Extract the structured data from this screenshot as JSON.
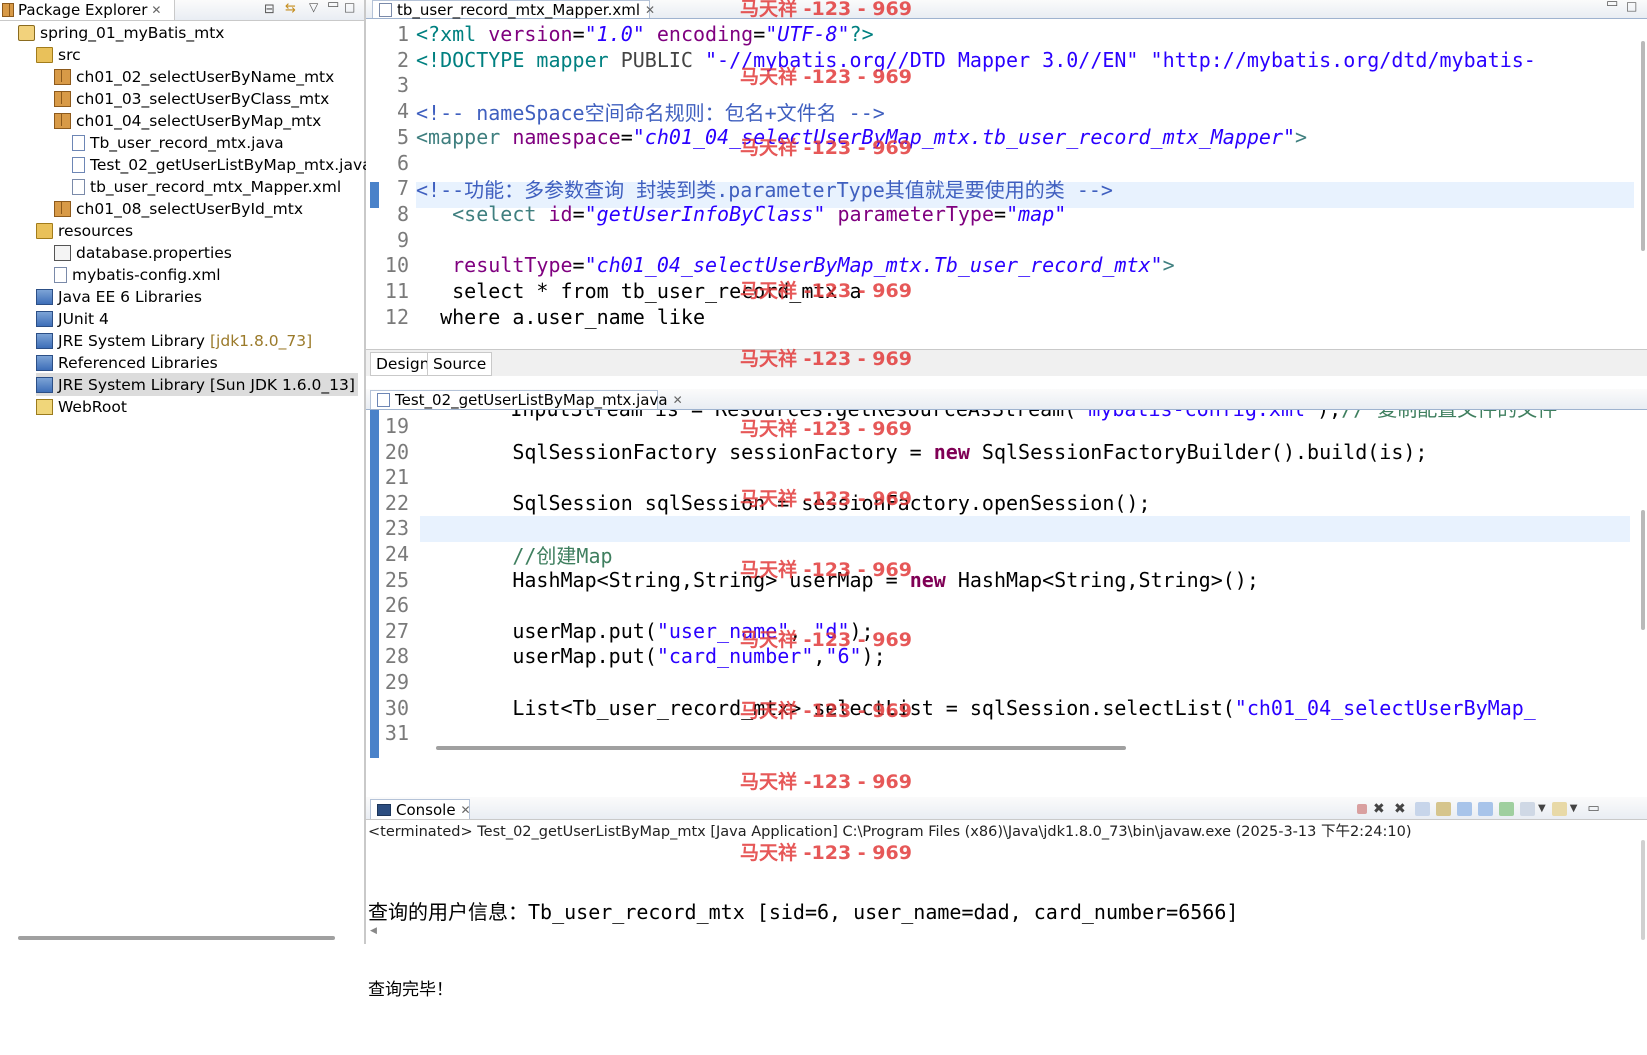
{
  "package_explorer": {
    "tab_label": "Package Explorer",
    "tree": [
      {
        "label": "spring_01_myBatis_mtx",
        "icon": "project-icon",
        "depth": 0
      },
      {
        "label": "src",
        "icon": "source-folder-icon",
        "depth": 1
      },
      {
        "label": "ch01_02_selectUserByName_mtx",
        "icon": "package-icon",
        "depth": 2
      },
      {
        "label": "ch01_03_selectUserByClass_mtx",
        "icon": "package-icon",
        "depth": 2
      },
      {
        "label": "ch01_04_selectUserByMap_mtx",
        "icon": "package-icon",
        "depth": 2
      },
      {
        "label": "Tb_user_record_mtx.java",
        "icon": "java-file-icon",
        "depth": 3
      },
      {
        "label": "Test_02_getUserListByMap_mtx.java",
        "icon": "java-file-icon",
        "depth": 3
      },
      {
        "label": "tb_user_record_mtx_Mapper.xml",
        "icon": "xml-file-icon",
        "depth": 3
      },
      {
        "label": "ch01_08_selectUserById_mtx",
        "icon": "package-icon",
        "depth": 2
      },
      {
        "label": "resources",
        "icon": "source-folder-icon",
        "depth": 1
      },
      {
        "label": "database.properties",
        "icon": "properties-file-icon",
        "depth": 2
      },
      {
        "label": "mybatis-config.xml",
        "icon": "xml-file-icon",
        "depth": 2
      },
      {
        "label": "Java EE 6 Libraries",
        "icon": "library-icon",
        "depth": 1
      },
      {
        "label": "JUnit 4",
        "icon": "library-icon",
        "depth": 1
      },
      {
        "label": "JRE System Library",
        "extra": "[jdk1.8.0_73]",
        "icon": "library-icon",
        "depth": 1
      },
      {
        "label": "Referenced Libraries",
        "icon": "library-icon",
        "depth": 1
      },
      {
        "label": "JRE System Library [Sun JDK 1.6.0_13]",
        "icon": "library-icon",
        "depth": 1,
        "selected": true
      },
      {
        "label": "WebRoot",
        "icon": "folder-icon",
        "depth": 1
      }
    ]
  },
  "editor_xml": {
    "tab_label": "tb_user_record_mtx_Mapper.xml",
    "bottom_tabs": [
      "Design",
      "Source"
    ],
    "lines": [
      {
        "n": "1",
        "html": "<span class=\"xdecl\">&lt;?xml</span> <span class=\"xattr\">version</span>=<span class=\"xval\">\"1.0\"</span> <span class=\"xattr\">encoding</span>=<span class=\"xval\">\"UTF-8\"</span><span class=\"xdecl\">?&gt;</span>"
      },
      {
        "n": "2",
        "html": "<span class=\"xdecl\">&lt;!DOCTYPE mapper</span> <span style=\"color:#444\">PUBLIC</span> <span class=\"str\">\"-//mybatis.org//DTD Mapper 3.0//EN\"</span> <span class=\"str\">\"http://mybatis.org/dtd/mybatis-</span>"
      },
      {
        "n": "3",
        "html": ""
      },
      {
        "n": "4",
        "html": "<span class=\"xcmt\">&lt;!-- nameSpace空间命名规则：包名+文件名 --&gt;</span>"
      },
      {
        "n": "5",
        "html": "<span class=\"xmltag\">&lt;mapper</span> <span class=\"xattr\">namespace</span>=<span class=\"xval\">\"ch01_04_selectUserByMap_mtx.tb_user_record_mtx_Mapper\"</span><span class=\"xmltag\">&gt;</span>"
      },
      {
        "n": "6",
        "html": ""
      },
      {
        "n": "7",
        "html": "<span class=\"xcmt\">&lt;!--功能：多参数查询 封装到类.parameterType其值就是要使用的类 --&gt;</span>"
      },
      {
        "n": "8",
        "html": "   <span class=\"xmltag\">&lt;select</span> <span class=\"xattr\">id</span>=<span class=\"xval\">\"getUserInfoByClass\"</span> <span class=\"xattr\">parameterType</span>=<span class=\"xval\">\"map\"</span>"
      },
      {
        "n": "9",
        "html": ""
      },
      {
        "n": "10",
        "html": "   <span class=\"xattr\">resultType</span>=<span class=\"xval\">\"ch01_04_selectUserByMap_mtx.Tb_user_record_mtx\"</span><span class=\"xmltag\">&gt;</span>"
      },
      {
        "n": "11",
        "html": "   select * from tb_user_record_mtx a"
      },
      {
        "n": "12",
        "html": "  where a.user_name like"
      }
    ]
  },
  "editor_java": {
    "tab_label": "Test_02_getUserListByMap_mtx.java",
    "partial_line_html": "        <span>InputStream is = Resources.getResourceAsStream(</span><span class=\"str\">\"mybatis-config.xml\"</span>);<span class=\"cmt\">// 复制配置文件的文件</span>",
    "lines": [
      {
        "n": "19",
        "html": ""
      },
      {
        "n": "20",
        "html": "        SqlSessionFactory sessionFactory = <span class=\"kw\">new</span> SqlSessionFactoryBuilder().build(is);"
      },
      {
        "n": "21",
        "html": ""
      },
      {
        "n": "22",
        "html": "        SqlSession sqlSession = sessionFactory.openSession();"
      },
      {
        "n": "23",
        "html": ""
      },
      {
        "n": "24",
        "html": "        <span class=\"cmt\">//创建Map</span>"
      },
      {
        "n": "25",
        "html": "        HashMap&lt;String,String&gt; userMap = <span class=\"kw\">new</span> HashMap&lt;String,String&gt;();"
      },
      {
        "n": "26",
        "html": ""
      },
      {
        "n": "27",
        "html": "        userMap.put(<span class=\"str\">\"user_name\"</span>, <span class=\"str\">\"d\"</span>);"
      },
      {
        "n": "28",
        "html": "        userMap.put(<span class=\"str\">\"card_number\"</span>,<span class=\"str\">\"6\"</span>);"
      },
      {
        "n": "29",
        "html": ""
      },
      {
        "n": "30",
        "html": "        List&lt;Tb_user_record_mtx&gt; selectList = sqlSession.selectList(<span class=\"str\">\"ch01_04_selectUserByMap_</span>"
      },
      {
        "n": "31",
        "html": ""
      }
    ]
  },
  "console": {
    "tab_label": "Console",
    "status": "<terminated> Test_02_getUserListByMap_mtx [Java Application] C:\\Program Files (x86)\\Java\\jdk1.8.0_73\\bin\\javaw.exe (2025-3-13 下午2:24:10)",
    "output": [
      "查询的用户信息：Tb_user_record_mtx [sid=6, user_name=dad, card_number=6566]",
      "查询完毕！"
    ]
  },
  "watermark": "马天祥 -123 - 969"
}
